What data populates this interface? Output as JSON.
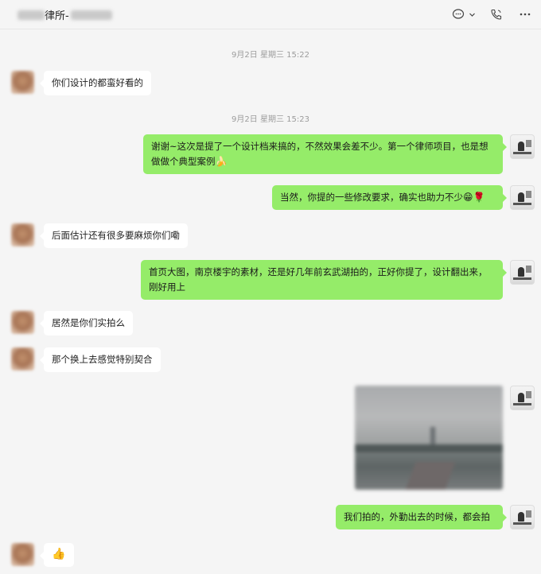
{
  "window": {
    "title_visible": "律所-",
    "icons": [
      "chat-bubble-icon",
      "chevron-down-icon",
      "phone-icon",
      "more-icon"
    ]
  },
  "timestamps": [
    "9月2日 星期三 15:22",
    "9月2日 星期三 15:23"
  ],
  "messages": [
    {
      "from": "other",
      "text": "你们设计的都蛮好看的"
    },
    {
      "from": "me",
      "line1": "谢谢~这次是提了一个设计档来搞的，不然效果会差不少。第一个律师项目，也是想",
      "line2": "做做个典型案例",
      "emoji": "🍌"
    },
    {
      "from": "me",
      "text": "当然，你提的一些修改要求，确实也助力不少",
      "emoji": "😁🌹"
    },
    {
      "from": "other",
      "text": "后面估计还有很多要麻烦你们嘞"
    },
    {
      "from": "me",
      "line1": "首页大图，南京楼宇的素材，还是好几年前玄武湖拍的，正好你提了，设计翻出来，",
      "line2": "刚好用上"
    },
    {
      "from": "other",
      "text": "居然是你们实拍么"
    },
    {
      "from": "other",
      "text": "那个换上去感觉特别契合"
    },
    {
      "from": "me",
      "type": "image",
      "description_icon": "photo-icon"
    },
    {
      "from": "me",
      "text": "我们拍的，外勤出去的时候，都会拍"
    },
    {
      "from": "other",
      "emoji": "👍"
    }
  ]
}
